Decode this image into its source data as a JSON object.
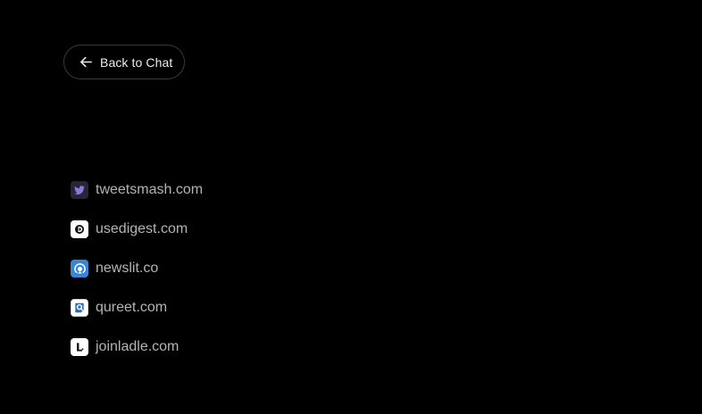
{
  "back_button": {
    "label": "Back to Chat",
    "icon": "arrow-left-icon"
  },
  "sites": [
    {
      "label": "tweetsmash.com",
      "icon": "tweetsmash-favicon-icon"
    },
    {
      "label": "usedigest.com",
      "icon": "usedigest-favicon-icon"
    },
    {
      "label": "newslit.co",
      "icon": "newslit-favicon-icon"
    },
    {
      "label": "qureet.com",
      "icon": "qureet-favicon-icon"
    },
    {
      "label": "joinladle.com",
      "icon": "joinladle-favicon-icon"
    }
  ],
  "colors": {
    "background": "#000000",
    "button_border": "#3a3a3a",
    "button_text": "#ececec",
    "site_text": "#b4b4b4"
  }
}
